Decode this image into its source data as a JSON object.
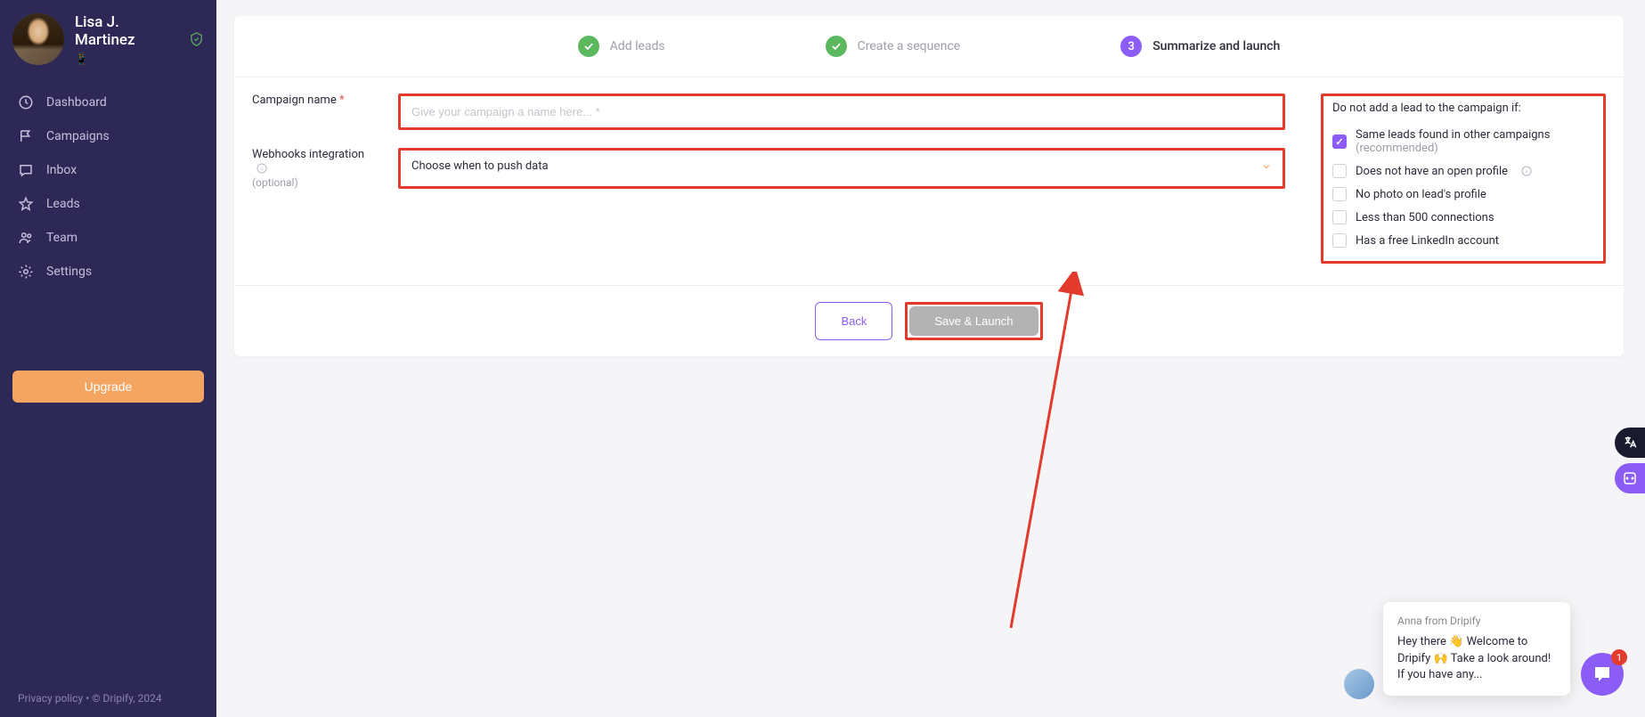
{
  "profile": {
    "name": "Lisa J. Martinez",
    "sub": "📱"
  },
  "nav": {
    "dashboard": "Dashboard",
    "campaigns": "Campaigns",
    "inbox": "Inbox",
    "leads": "Leads",
    "team": "Team",
    "settings": "Settings",
    "upgrade": "Upgrade"
  },
  "footer": {
    "privacy": "Privacy policy",
    "sep": "  •  ",
    "copyright": "© Dripify, 2024"
  },
  "stepper": {
    "step1": "Add leads",
    "step2": "Create a sequence",
    "step3_num": "3",
    "step3": "Summarize and launch"
  },
  "form": {
    "name_label": "Campaign name",
    "name_placeholder": "Give your campaign a name here... *",
    "webhooks_label": "Webhooks integration",
    "webhooks_sub": "(optional)",
    "webhooks_select": "Choose when to push data"
  },
  "filters": {
    "title": "Do not add a lead to the campaign if:",
    "opt1": "Same leads found in other campaigns",
    "opt1_rec": "(recommended)",
    "opt2": "Does not have an open profile",
    "opt3": "No photo on lead's profile",
    "opt4": "Less than 500 connections",
    "opt5": "Has a free LinkedIn account"
  },
  "buttons": {
    "back": "Back",
    "save": "Save & Launch"
  },
  "chat": {
    "from": "Anna from Dripify",
    "msg": "Hey there 👋 Welcome to Dripify 🙌 Take a look around! If you have any...",
    "badge": "1"
  }
}
